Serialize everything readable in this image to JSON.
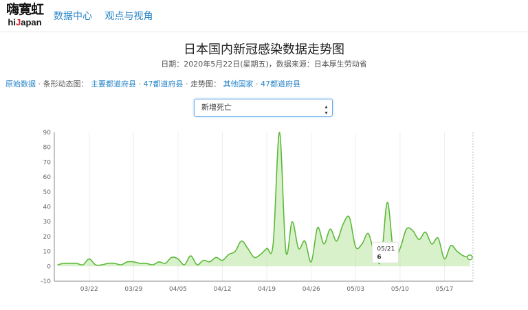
{
  "logo": {
    "cn": "嗨寛虹",
    "en_pre": "hi",
    "en_j": "J",
    "en_post": "apan"
  },
  "nav": {
    "item1": "数据中心",
    "item2": "观点与视角"
  },
  "page": {
    "title": "日本国内新冠感染数据走势图",
    "subtitle": "日期：2020年5月22日(星期五)，数据来源：日本厚生劳动省"
  },
  "links": {
    "raw": "原始数据",
    "sep1": "· 条形动态图：",
    "major": "主要都道府县",
    "sep2": "·",
    "p47a": "47都道府县",
    "sep3": "· 走势图：",
    "other": "其他国家",
    "sep4": "·",
    "p47b": "47都道府县"
  },
  "select": {
    "value": "新增死亡"
  },
  "chart_data": {
    "type": "line",
    "x": [
      "03/17",
      "03/18",
      "03/19",
      "03/20",
      "03/21",
      "03/22",
      "03/23",
      "03/24",
      "03/25",
      "03/26",
      "03/27",
      "03/28",
      "03/29",
      "03/30",
      "03/31",
      "04/01",
      "04/02",
      "04/03",
      "04/04",
      "04/05",
      "04/06",
      "04/07",
      "04/08",
      "04/09",
      "04/10",
      "04/11",
      "04/12",
      "04/13",
      "04/14",
      "04/15",
      "04/16",
      "04/17",
      "04/18",
      "04/19",
      "04/20",
      "04/21",
      "04/22",
      "04/23",
      "04/24",
      "04/25",
      "04/26",
      "04/27",
      "04/28",
      "04/29",
      "04/30",
      "05/01",
      "05/02",
      "05/03",
      "05/04",
      "05/05",
      "05/06",
      "05/07",
      "05/08",
      "05/09",
      "05/10",
      "05/11",
      "05/12",
      "05/13",
      "05/14",
      "05/15",
      "05/16",
      "05/17",
      "05/18",
      "05/19",
      "05/20",
      "05/21"
    ],
    "values": [
      1,
      2,
      2,
      2,
      1,
      5,
      1,
      1,
      2,
      2,
      1,
      3,
      3,
      2,
      2,
      1,
      3,
      2,
      6,
      5,
      1,
      7,
      1,
      4,
      3,
      6,
      4,
      8,
      10,
      17,
      12,
      6,
      8,
      12,
      15,
      90,
      10,
      30,
      12,
      17,
      3,
      26,
      15,
      25,
      17,
      28,
      33,
      13,
      15,
      22,
      8,
      4,
      43,
      8,
      12,
      25,
      24,
      18,
      23,
      15,
      19,
      5,
      14,
      10,
      7,
      6
    ],
    "xticks": [
      "03/22",
      "03/29",
      "04/05",
      "04/12",
      "04/19",
      "04/26",
      "05/03",
      "05/10",
      "05/17"
    ],
    "yticks": [
      -10,
      0,
      10,
      20,
      30,
      40,
      50,
      60,
      70,
      80,
      90
    ],
    "ylim": [
      -10,
      90
    ],
    "grid": "vertical",
    "tooltip": {
      "date": "05/21",
      "value": "6"
    },
    "colors": {
      "line": "#5cb83a",
      "fill": "#a8e08a",
      "grid": "#eeeeee",
      "axis": "#888888"
    }
  }
}
